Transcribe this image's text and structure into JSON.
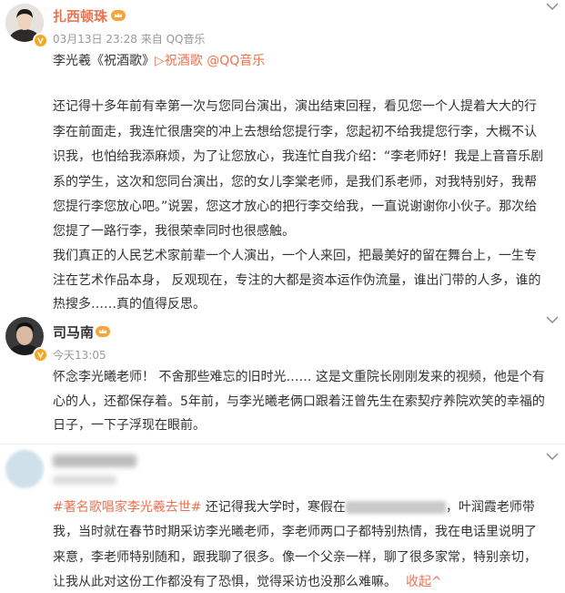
{
  "post1": {
    "author": "扎西顿珠",
    "meta": "03月13日 23:28  来自 QQ音乐",
    "song_prefix": "李光羲《祝酒歌》",
    "song_link": "▷祝酒歌 @QQ音乐",
    "body": [
      "还记得十多年前有幸第一次与您同台演出，演出结束回程，看见您一个人提着大大的行",
      "李在前面走，我连忙很唐突的冲上去想给您提行李，您起初不给我提您行李，大概不认",
      "识我，也怕给我添麻烦，为了让您放心，我连忙自我介绍：“李老师好！我是上音音乐剧",
      "系的学生，这次和您同台演出，您的女儿李棠老师，是我们系老师，对我特别好，我帮",
      "您提行李您放心吧。”说罢，您这才放心的把行李交给我，一直说谢谢你小伙子。那次给",
      "您提了一路行李，我很荣幸同时也很感触。",
      "我们真正的人民艺术家前辈一个人演出，一个人来回，把最美好的留在舞台上，一生专",
      "注在艺术作品本身， 反观现在，专注的大都是资本运作伪流量，谁出门带的人多，谁的",
      "热搜多……真的值得反思。"
    ]
  },
  "post2": {
    "author": "司马南",
    "meta": "今天13:05",
    "body": [
      "怀念李光曦老师！ 不舍那些难忘的旧时光…… 这是文重院长刚刚发来的视频，他是个有",
      "心的人，还都保存着。5年前，与李光曦老俩口跟着汪曾先生在索契疗养院欢笑的幸福的",
      "日子，一下子浮现在眼前。"
    ]
  },
  "post3": {
    "hashtag": "#著名歌唱家李光羲去世#",
    "line1_a": " 还记得我大学时，寒假在",
    "line1_b": "，叶润霞老师带",
    "body": [
      "我，当时就在春节时期采访李光曦老师，李老师两口子都特别热情，我在电话里说明了",
      "来意，李老师特别随和，跟我聊了很多。像一个父亲一样，聊了很多家常，特别亲切，"
    ],
    "last_line": "让我从此对这份工作都没有了恐惧，觉得采访也没那么难嘛。",
    "collapse": "收起^"
  },
  "colors": {
    "author_orange": "#eb7350",
    "text": "#333333",
    "meta": "#999999",
    "link": "#eb7350"
  }
}
